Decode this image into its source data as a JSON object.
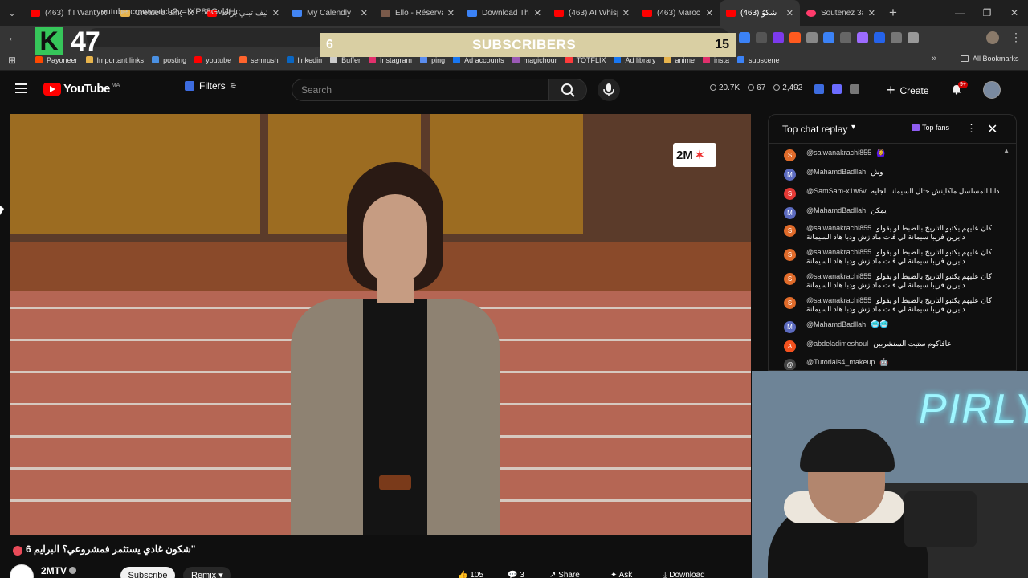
{
  "browser": {
    "tabs": [
      {
        "title": "(463) If I Want",
        "color": "#ff0000"
      },
      {
        "title": "Create a Single",
        "color": "#e8b44c"
      },
      {
        "title": "كيف تبني براند",
        "color": "#ff0000"
      },
      {
        "title": "My Calendly",
        "color": "#4285f4"
      },
      {
        "title": "Ello - Réservati",
        "color": "#7a5a4a"
      },
      {
        "title": "Download The",
        "color": "#3b82f6"
      },
      {
        "title": "(463) AI Whisp",
        "color": "#ff0000"
      },
      {
        "title": "(463) Maroc T",
        "color": "#ff0000"
      },
      {
        "title": "شكوُ (463)",
        "color": "#ff0000"
      },
      {
        "title": "Soutenez 3an",
        "color": "#ff3b6b"
      }
    ],
    "new_tab": "+",
    "address": "youtube.com/watch?v=IXP88Gvl4Hc",
    "bookmarks": [
      {
        "label": "Payoneer",
        "color": "#ff4800"
      },
      {
        "label": "Important links",
        "color": "#e8b44c"
      },
      {
        "label": "posting",
        "color": "#4a90e2"
      },
      {
        "label": "youtube",
        "color": "#ff0000"
      },
      {
        "label": "semrush",
        "color": "#ff642d"
      },
      {
        "label": "linkedin",
        "color": "#0a66c2"
      },
      {
        "label": "Buffer",
        "color": "#cccccc"
      },
      {
        "label": "Instagram",
        "color": "#e1306c"
      },
      {
        "label": "ping",
        "color": "#5b8def"
      },
      {
        "label": "Ad accounts",
        "color": "#1877f2"
      },
      {
        "label": "magichour",
        "color": "#9b59b6"
      },
      {
        "label": "TOTFLIX",
        "color": "#ff3b3b"
      },
      {
        "label": "Ad library",
        "color": "#1877f2"
      },
      {
        "label": "anime",
        "color": "#e8b44c"
      },
      {
        "label": "insta",
        "color": "#e1306c"
      },
      {
        "label": "subscene",
        "color": "#3b82f6"
      }
    ],
    "bookmarks_more": "»",
    "all_bookmarks": "All Bookmarks"
  },
  "overlay": {
    "kick_logo": "K",
    "viewer_count": "47",
    "sub_goal": {
      "current": "6",
      "label": "SUBSCRIBERS",
      "goal": "15"
    }
  },
  "header": {
    "region": "MA",
    "filters_label": "Filters",
    "search_placeholder": "Search",
    "stats": {
      "subs": "20.7K",
      "views": "67",
      "watch": "2,492"
    },
    "create_label": "Create",
    "notif_badge": "9+"
  },
  "video": {
    "channel_watermark": "2M",
    "title": "شكون غادي يستثمر فمشروعي؟ البرايم 6\"",
    "channel": "2MTV",
    "subscribe_label": "Subscribe",
    "remix_label": "Remix",
    "likes": "105",
    "comments": "3",
    "share_label": "Share",
    "ask_label": "Ask",
    "download_label": "Download"
  },
  "chat": {
    "title": "Top chat replay",
    "top_fans_label": "Top fans",
    "messages": [
      {
        "initial": "S",
        "color": "#e06b2a",
        "author": "@salwanakrachi855",
        "text": "🙆‍♀️",
        "text2": ""
      },
      {
        "initial": "M",
        "color": "#5c6bc0",
        "author": "@MahamdBadllah",
        "text": "وش",
        "text2": ""
      },
      {
        "initial": "S",
        "color": "#e53935",
        "author": "@SamSam-x1w6v",
        "text": "دابا المسلسل ماكاينش حتال السيمانا الجايه",
        "text2": ""
      },
      {
        "initial": "M",
        "color": "#5c6bc0",
        "author": "@MahamdBadllah",
        "text": "يمكن",
        "text2": ""
      },
      {
        "initial": "S",
        "color": "#e06b2a",
        "author": "@salwanakrachi855",
        "text": "كان عليهم يكتبو التاريخ بالضبط او يقولو",
        "text2": "دايرين فريبا سيمانة لي فات مادازش ودبا هاد السيمانة"
      },
      {
        "initial": "S",
        "color": "#e06b2a",
        "author": "@salwanakrachi855",
        "text": "كان عليهم يكتبو التاريخ بالضبط او يقولو",
        "text2": "دايرين فريبا سيمانة لي فات مادازش ودبا هاد السيمانة"
      },
      {
        "initial": "S",
        "color": "#e06b2a",
        "author": "@salwanakrachi855",
        "text": "كان عليهم يكتبو التاريخ بالضبط او يقولو",
        "text2": "دايرين فريبا سيمانة لي فات مادازش ودبا هاد السيمانة"
      },
      {
        "initial": "S",
        "color": "#e06b2a",
        "author": "@salwanakrachi855",
        "text": "كان عليهم يكتبو التاريخ بالضبط او يقولو",
        "text2": "دايرين فريبا سيمانة لي فات مادازش ودبا هاد السيمانة"
      },
      {
        "initial": "M",
        "color": "#5c6bc0",
        "author": "@MahamdBadllah",
        "text": "🥶🥶",
        "text2": ""
      },
      {
        "initial": "A",
        "color": "#f4511e",
        "author": "@abdeladimeshoul",
        "text": "عافاكوم ستيت السنشربين",
        "text2": ""
      },
      {
        "initial": "@",
        "color": "#444444",
        "author": "@Tutorials4_makeup",
        "text": "🤖",
        "text2": ""
      }
    ]
  },
  "webcam": {
    "neon_sign": "PIRLY"
  }
}
